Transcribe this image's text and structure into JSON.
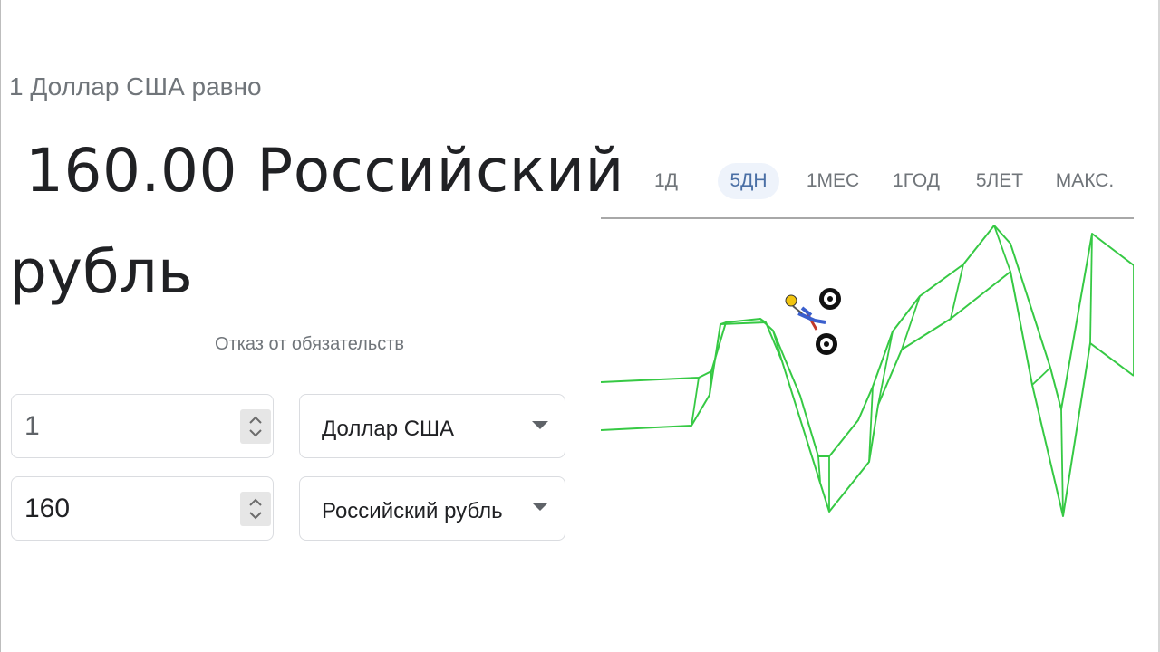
{
  "header": {
    "subtitle": "1 Доллар США равно",
    "converted_value": "160.00 Российский",
    "converted_unit": "рубль"
  },
  "disclaimer": "Отказ от обязательств",
  "converter": {
    "from_amount": "1",
    "to_amount": "160",
    "from_currency": "Доллар США",
    "to_currency": "Российский рубль"
  },
  "tabs": [
    {
      "label": "1Д",
      "active": false
    },
    {
      "label": "5ДН",
      "active": true
    },
    {
      "label": "1МЕС",
      "active": false
    },
    {
      "label": "1ГОД",
      "active": false
    },
    {
      "label": "5ЛЕТ",
      "active": false
    },
    {
      "label": "МАКС.",
      "active": false
    }
  ],
  "colors": {
    "track_line": "#2ecc40",
    "active_tab": "#4a6fa5"
  },
  "icons": {
    "spinner": "up-down-chevron-icon",
    "dropdown": "caret-down-icon",
    "rider": "motorbike-rider-icon"
  }
}
